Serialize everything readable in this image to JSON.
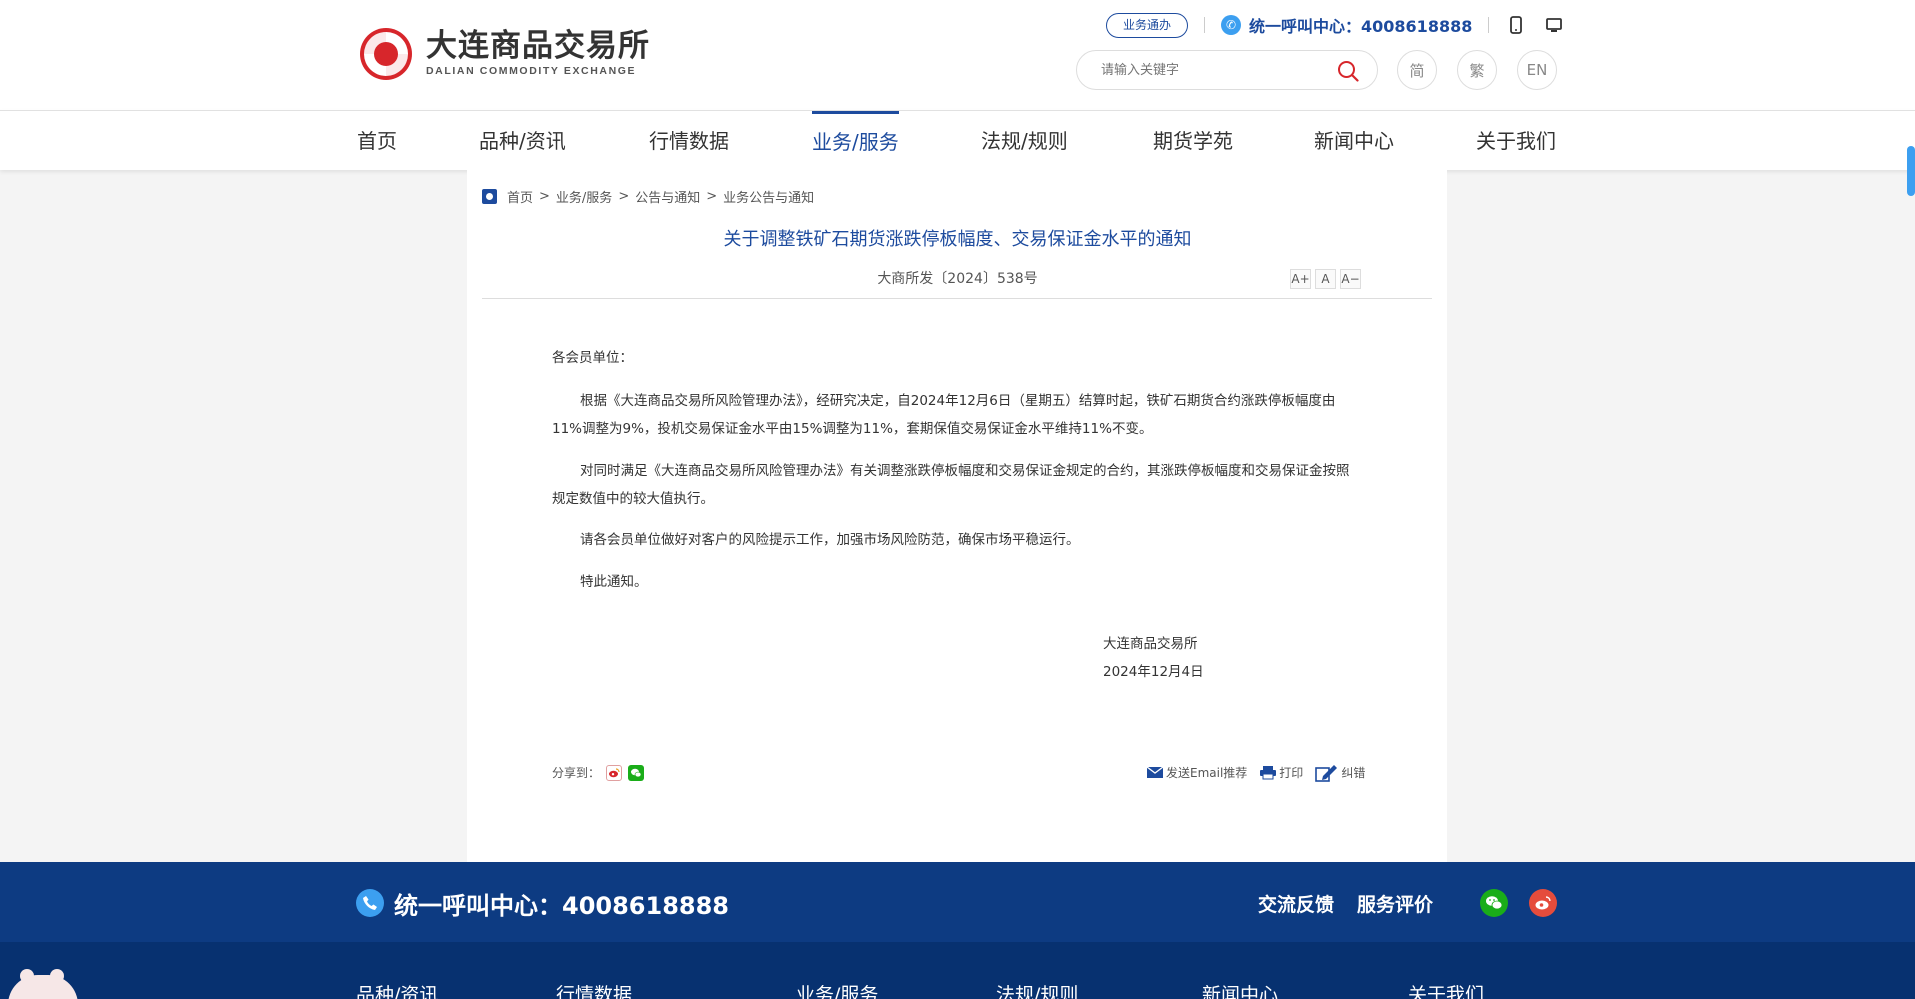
{
  "header": {
    "logo_cn": "大连商品交易所",
    "logo_en": "DALIAN COMMODITY EXCHANGE",
    "biz_button": "业务通办",
    "hotline": "统一呼叫中心：4008618888",
    "search_placeholder": "请输入关键字",
    "lang": [
      "简",
      "繁",
      "EN"
    ]
  },
  "nav": [
    {
      "label": "首页"
    },
    {
      "label": "品种/资讯"
    },
    {
      "label": "行情数据"
    },
    {
      "label": "业务/服务",
      "active": true
    },
    {
      "label": "法规/规则"
    },
    {
      "label": "期货学苑"
    },
    {
      "label": "新闻中心"
    },
    {
      "label": "关于我们"
    }
  ],
  "breadcrumb": [
    "首页",
    "业务/服务",
    "公告与通知",
    "业务公告与通知"
  ],
  "article": {
    "title": "关于调整铁矿石期货涨跌停板幅度、交易保证金水平的通知",
    "doc_no": "大商所发〔2024〕538号",
    "font_sizes": [
      "A+",
      "A",
      "A−"
    ],
    "salutation": "各会员单位：",
    "paragraphs": [
      "根据《大连商品交易所风险管理办法》，经研究决定，自2024年12月6日（星期五）结算时起，铁矿石期货合约涨跌停板幅度由11%调整为9%，投机交易保证金水平由15%调整为11%，套期保值交易保证金水平维持11%不变。",
      "对同时满足《大连商品交易所风险管理办法》有关调整涨跌停板幅度和交易保证金规定的合约，其涨跌停板幅度和交易保证金按照规定数值中的较大值执行。",
      "请各会员单位做好对客户的风险提示工作，加强市场风险防范，确保市场平稳运行。",
      "特此通知。"
    ],
    "signer": "大连商品交易所",
    "date": "2024年12月4日"
  },
  "share": {
    "label": "分享到："
  },
  "tools": {
    "email": "发送Email推荐",
    "print": "打印",
    "correct": "纠错"
  },
  "footer": {
    "hotline": "统一呼叫中心：4008618888",
    "feedback": "交流反馈",
    "rating": "服务评价",
    "nav": [
      "品种/资讯",
      "行情数据",
      "业务/服务",
      "法规/规则",
      "新闻中心",
      "关于我们"
    ]
  },
  "colors": {
    "primary": "#1d4b9e",
    "accent_red": "#d7262b",
    "footer_bg": "#0d3b82"
  }
}
